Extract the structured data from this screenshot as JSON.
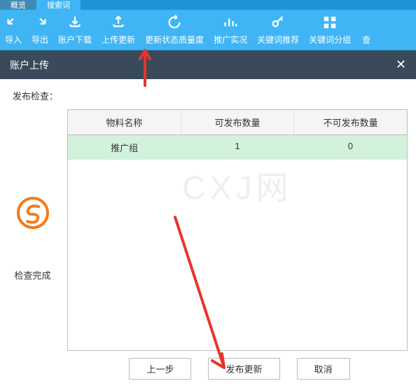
{
  "tabs": {
    "first": "概览",
    "second": "搜索词"
  },
  "toolbar": {
    "import": "导入",
    "export": "导出",
    "download": "账户下载",
    "upload": "上传更新",
    "refresh": "更新状态质量度",
    "status": "推广实况",
    "keyword": "关键词推荐",
    "group": "关键词分组",
    "more": "查"
  },
  "modal": {
    "title": "账户上传",
    "check_label": "发布检查：",
    "status_text": "检查完成",
    "watermark": "CXJ网"
  },
  "table": {
    "headers": [
      "物料名称",
      "可发布数量",
      "不可发布数量"
    ],
    "rows": [
      {
        "name": "推广组",
        "publishable": "1",
        "unpublishable": "0"
      }
    ]
  },
  "buttons": {
    "prev": "上一步",
    "publish": "发布更新",
    "cancel": "取消"
  }
}
